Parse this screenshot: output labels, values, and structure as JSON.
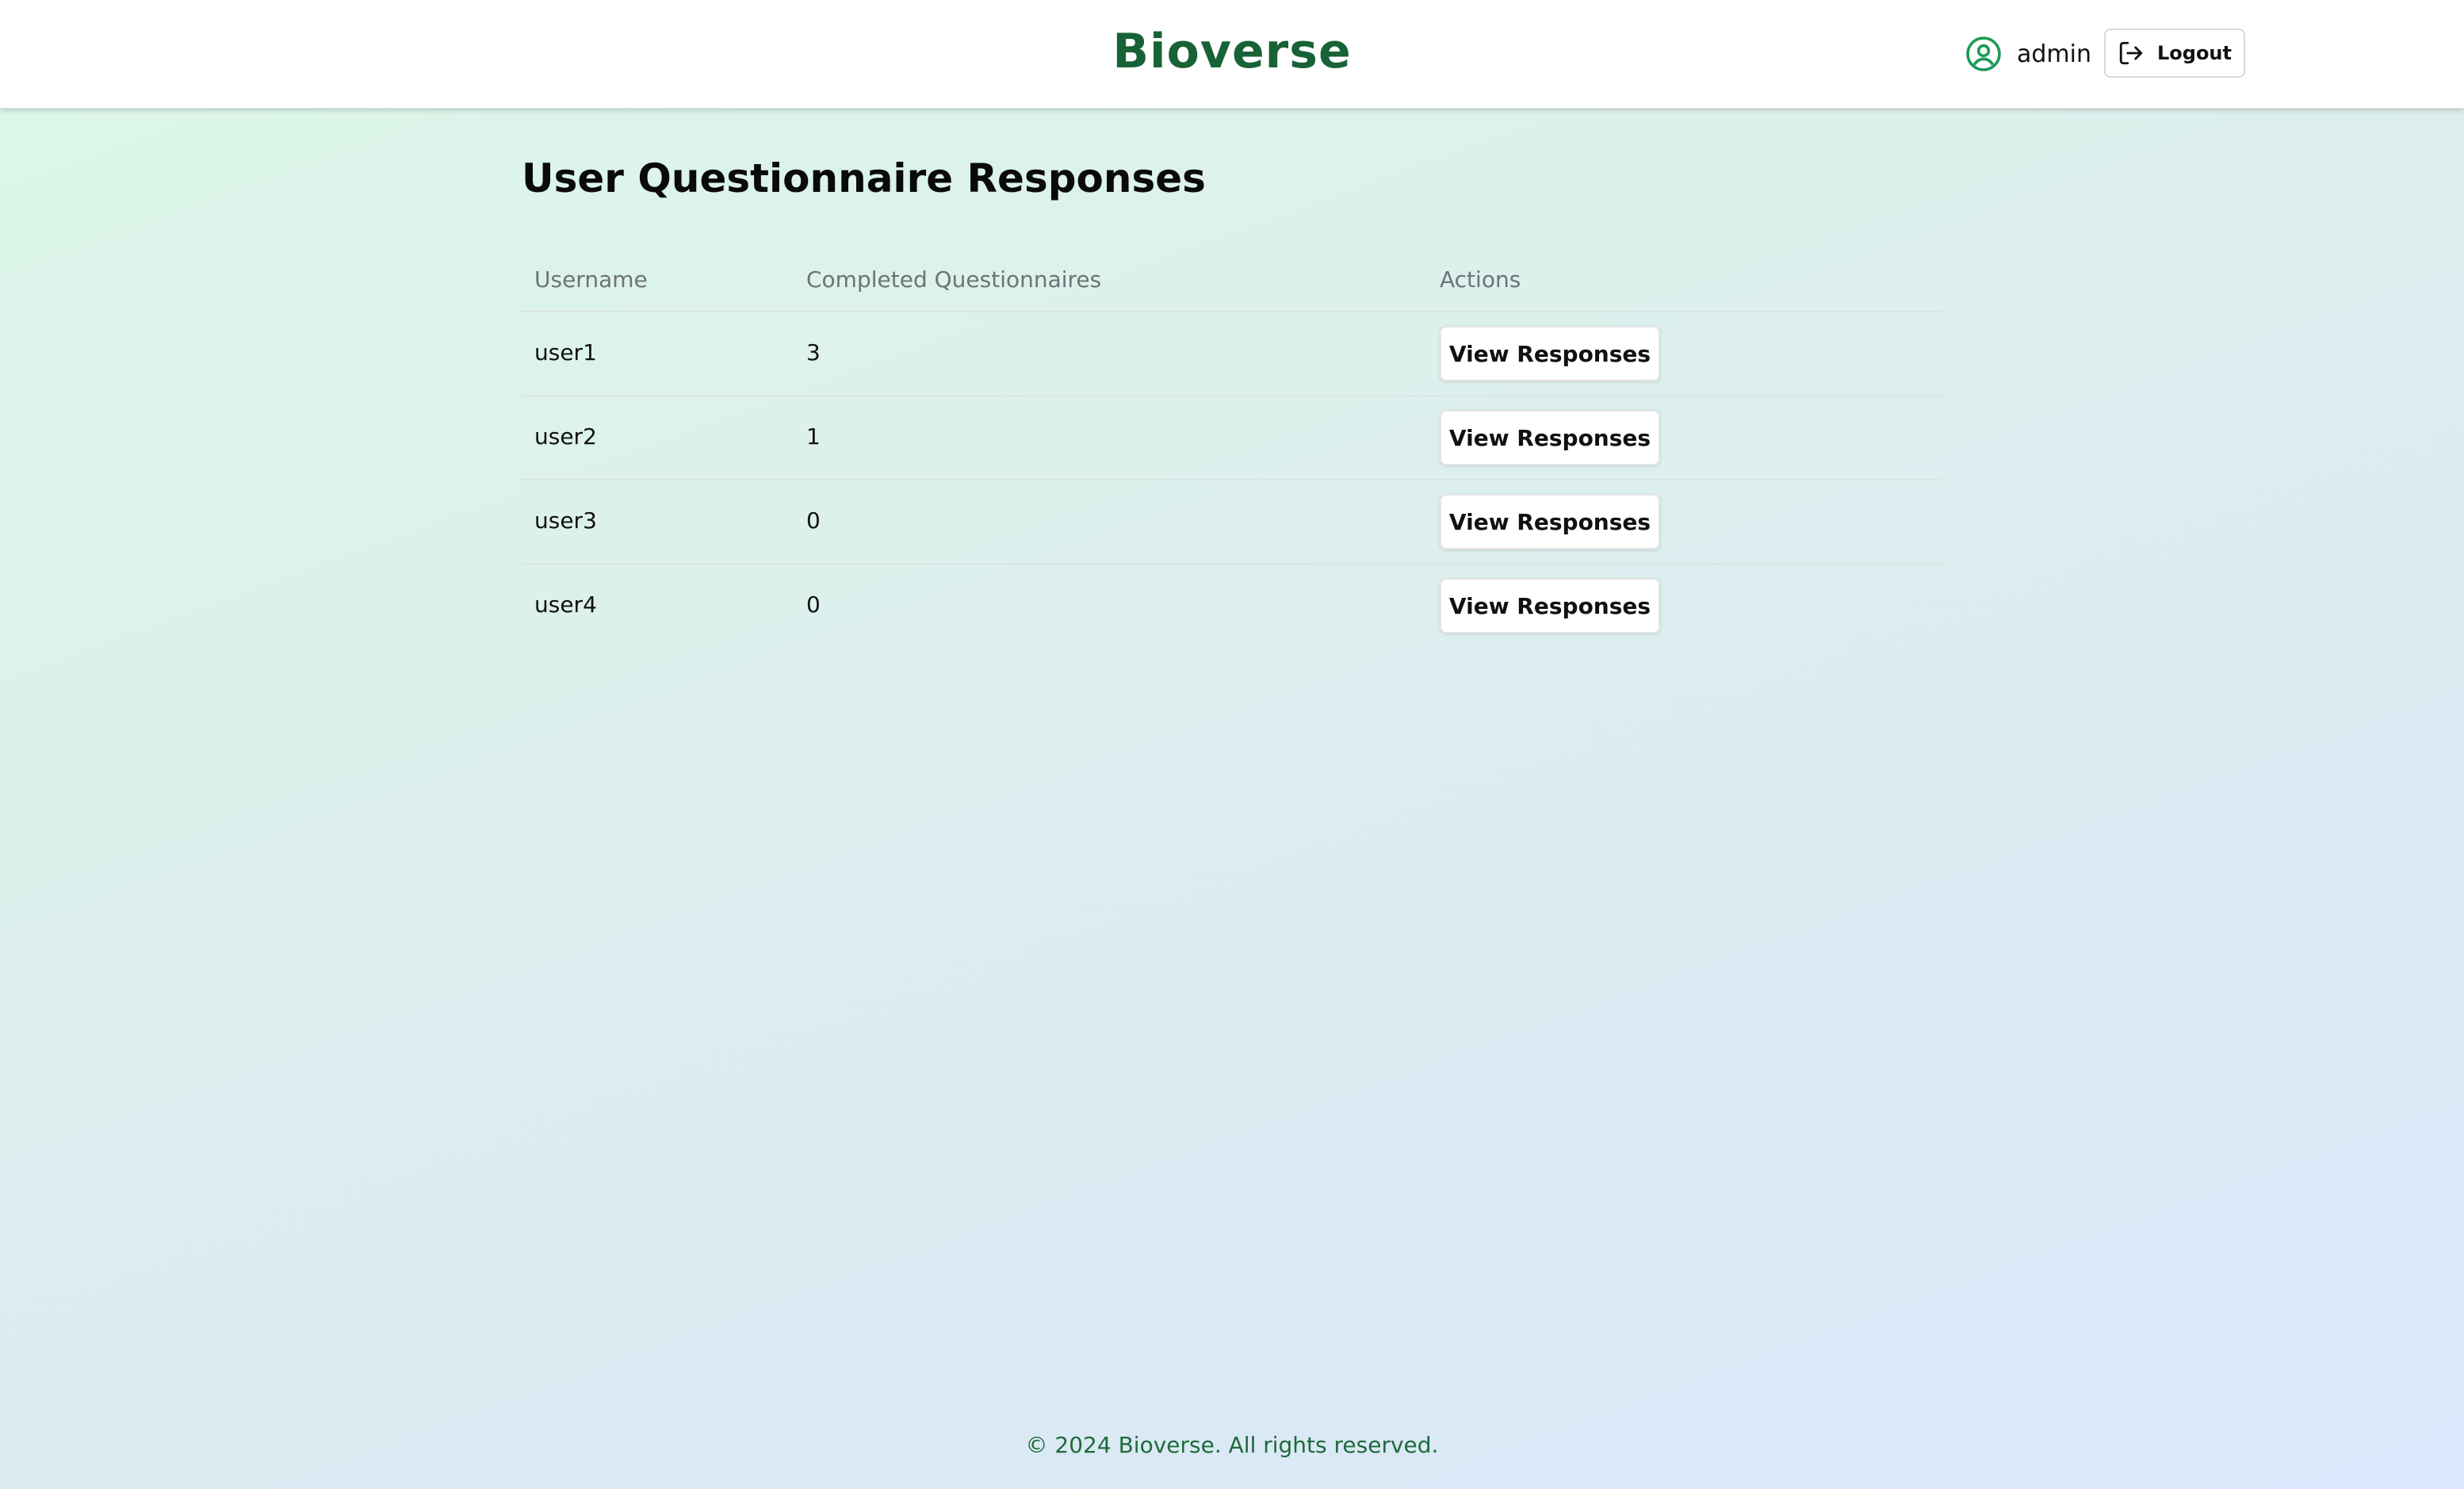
{
  "header": {
    "brand": "Bioverse",
    "username": "admin",
    "logout_label": "Logout",
    "user_icon": "user-circle-icon",
    "logout_icon": "logout-icon"
  },
  "main": {
    "title": "User Questionnaire Responses",
    "table": {
      "columns": [
        "Username",
        "Completed Questionnaires",
        "Actions"
      ],
      "rows": [
        {
          "username": "user1",
          "completed": "3",
          "action": "View Responses"
        },
        {
          "username": "user2",
          "completed": "1",
          "action": "View Responses"
        },
        {
          "username": "user3",
          "completed": "0",
          "action": "View Responses"
        },
        {
          "username": "user4",
          "completed": "0",
          "action": "View Responses"
        }
      ]
    }
  },
  "footer": {
    "text": "© 2024 Bioverse. All rights reserved."
  },
  "colors": {
    "brand": "#176236",
    "icon_accent": "#1a9a57"
  }
}
